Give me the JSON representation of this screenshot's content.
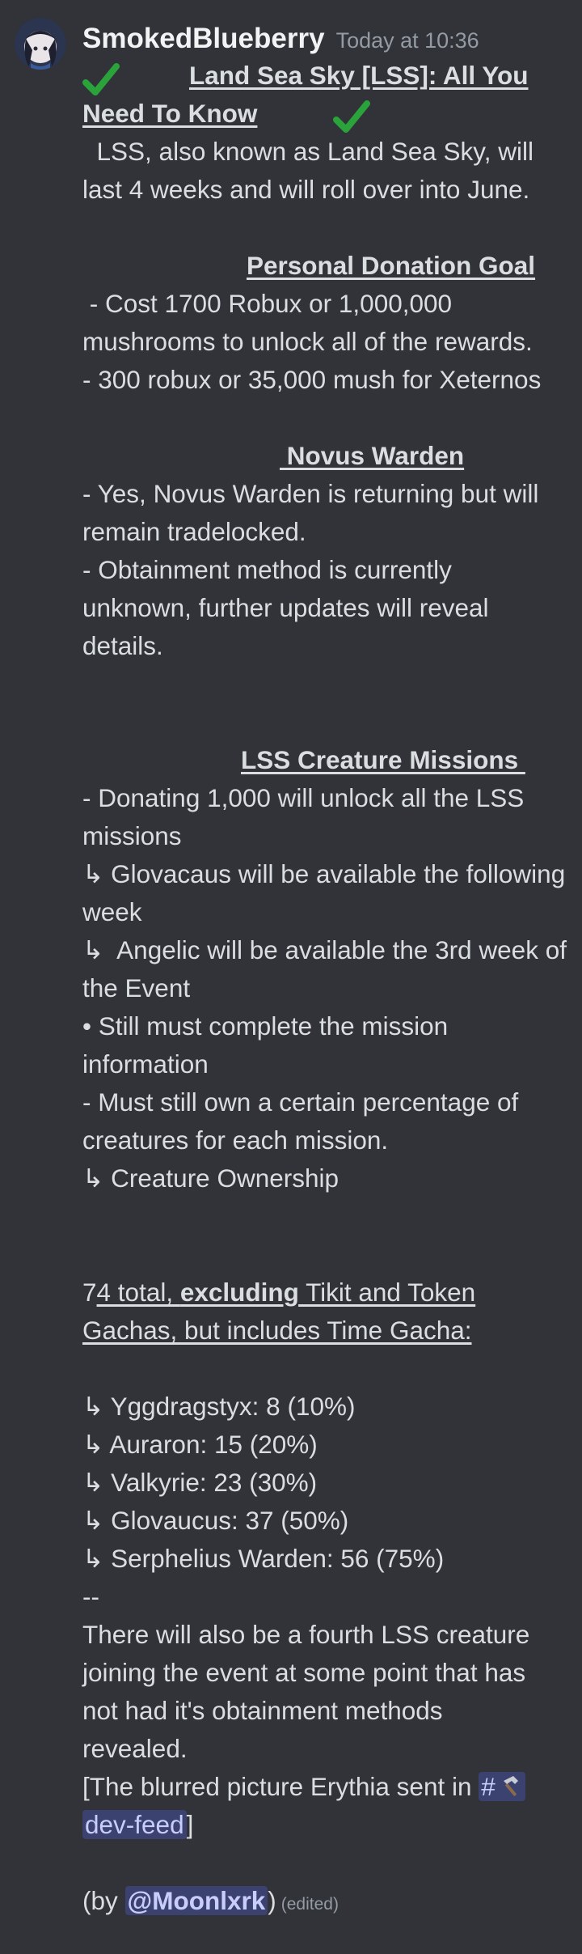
{
  "message": {
    "username": "SmokedBlueberry",
    "timestamp": "Today at 10:36",
    "title_line1": "Land Sea Sky [LSS]: All You",
    "title_line2": "Need To Know",
    "intro_1": "  LSS, also known as Land Sea Sky, will",
    "intro_2": "last 4 weeks and will roll over into June.",
    "donation_heading": "Personal Donation Goal",
    "donation_1": " - Cost 1700 Robux or 1,000,000",
    "donation_2": "mushrooms to unlock all of the rewards.",
    "donation_3": "- 300 robux or 35,000 mush for Xeternos",
    "novus_heading": " Novus Warden",
    "novus_1": "- Yes, Novus Warden is returning but will",
    "novus_2": "remain tradelocked.",
    "novus_3": "- Obtainment method is currently",
    "novus_4": "unknown, further updates will reveal",
    "novus_5": "details.",
    "missions_heading": "LSS Creature Missions ",
    "missions_1": "- Donating 1,000 will unlock all the LSS",
    "missions_2": "missions",
    "missions_3": "↳ Glovacaus will be available the following",
    "missions_4": "week",
    "missions_5": "↳  Angelic will be available the 3rd week of",
    "missions_6": "the Event",
    "missions_7": "• Still must complete the mission",
    "missions_8": "information",
    "missions_9": "- Must still own a certain percentage of",
    "missions_10": "creatures for each mission.",
    "missions_11": "↳ Creature Ownership",
    "total_prefix": "7",
    "total_a": "4 total, ",
    "total_bold": "excluding",
    "total_b": " Tikit and Token",
    "total_2": "Gachas, but includes Time Gacha:",
    "creatures": [
      "↳ Yggdragstyx: 8 (10%)",
      "↳ Auraron: 15 (20%)",
      "↳ Valkyrie: 23 (30%)",
      "↳ Glovaucus: 37 (50%)",
      "↳ Serphelius Warden: 56 (75%)"
    ],
    "separator": "--",
    "fourth_1": "There will also be a fourth LSS creature",
    "fourth_2": "joining the event at some point that has",
    "fourth_3": "not had it's obtainment methods",
    "fourth_4": "revealed.",
    "blurred_text": "[The blurred picture Erythia sent in ",
    "channel_hash": "#",
    "channel_name_1": "",
    "channel_name_2": "dev-feed",
    "blurred_close": "]",
    "by_open": "(by ",
    "mention": "@Moonlxrk",
    "by_close": ")",
    "edited": "(edited)"
  },
  "colors": {
    "background": "#313338",
    "text": "#dbdee1",
    "username": "#f2f3f5",
    "timestamp": "#949ba4",
    "mention_bg": "#3c4270",
    "mention_fg": "#c9cdfb",
    "check": "#2aa33a"
  }
}
